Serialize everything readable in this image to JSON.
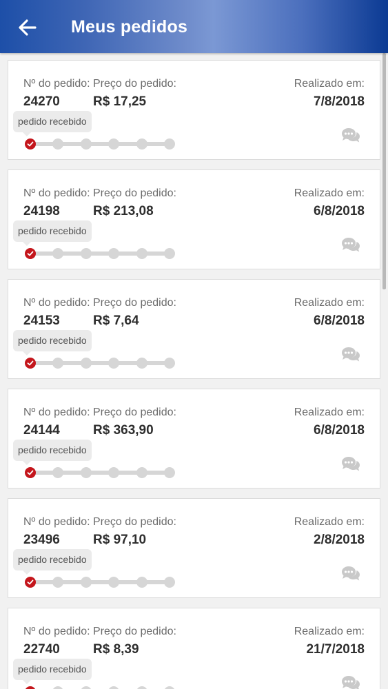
{
  "header": {
    "title": "Meus pedidos"
  },
  "labels": {
    "order_no": "Nº do pedido:",
    "price": "Preço do pedido:",
    "date": "Realizado em:"
  },
  "orders": [
    {
      "number": "24270",
      "price": "R$ 17,25",
      "date": "7/8/2018",
      "status": "pedido recebido",
      "progress_step": 1,
      "total_steps": 6
    },
    {
      "number": "24198",
      "price": "R$ 213,08",
      "date": "6/8/2018",
      "status": "pedido recebido",
      "progress_step": 1,
      "total_steps": 6
    },
    {
      "number": "24153",
      "price": "R$ 7,64",
      "date": "6/8/2018",
      "status": "pedido recebido",
      "progress_step": 1,
      "total_steps": 6
    },
    {
      "number": "24144",
      "price": "R$ 363,90",
      "date": "6/8/2018",
      "status": "pedido recebido",
      "progress_step": 1,
      "total_steps": 6
    },
    {
      "number": "23496",
      "price": "R$ 97,10",
      "date": "2/8/2018",
      "status": "pedido recebido",
      "progress_step": 1,
      "total_steps": 6
    },
    {
      "number": "22740",
      "price": "R$ 8,39",
      "date": "21/7/2018",
      "status": "pedido recebido",
      "progress_step": 1,
      "total_steps": 6
    }
  ],
  "icons": {
    "back": "arrow-left-icon",
    "chat": "chat-bubbles-icon",
    "check": "check-icon"
  },
  "colors": {
    "appbar_start": "#1d4fa8",
    "appbar_end": "#0b3a93",
    "progress_done": "#c4161c",
    "progress_pending": "#d6d6d6"
  }
}
